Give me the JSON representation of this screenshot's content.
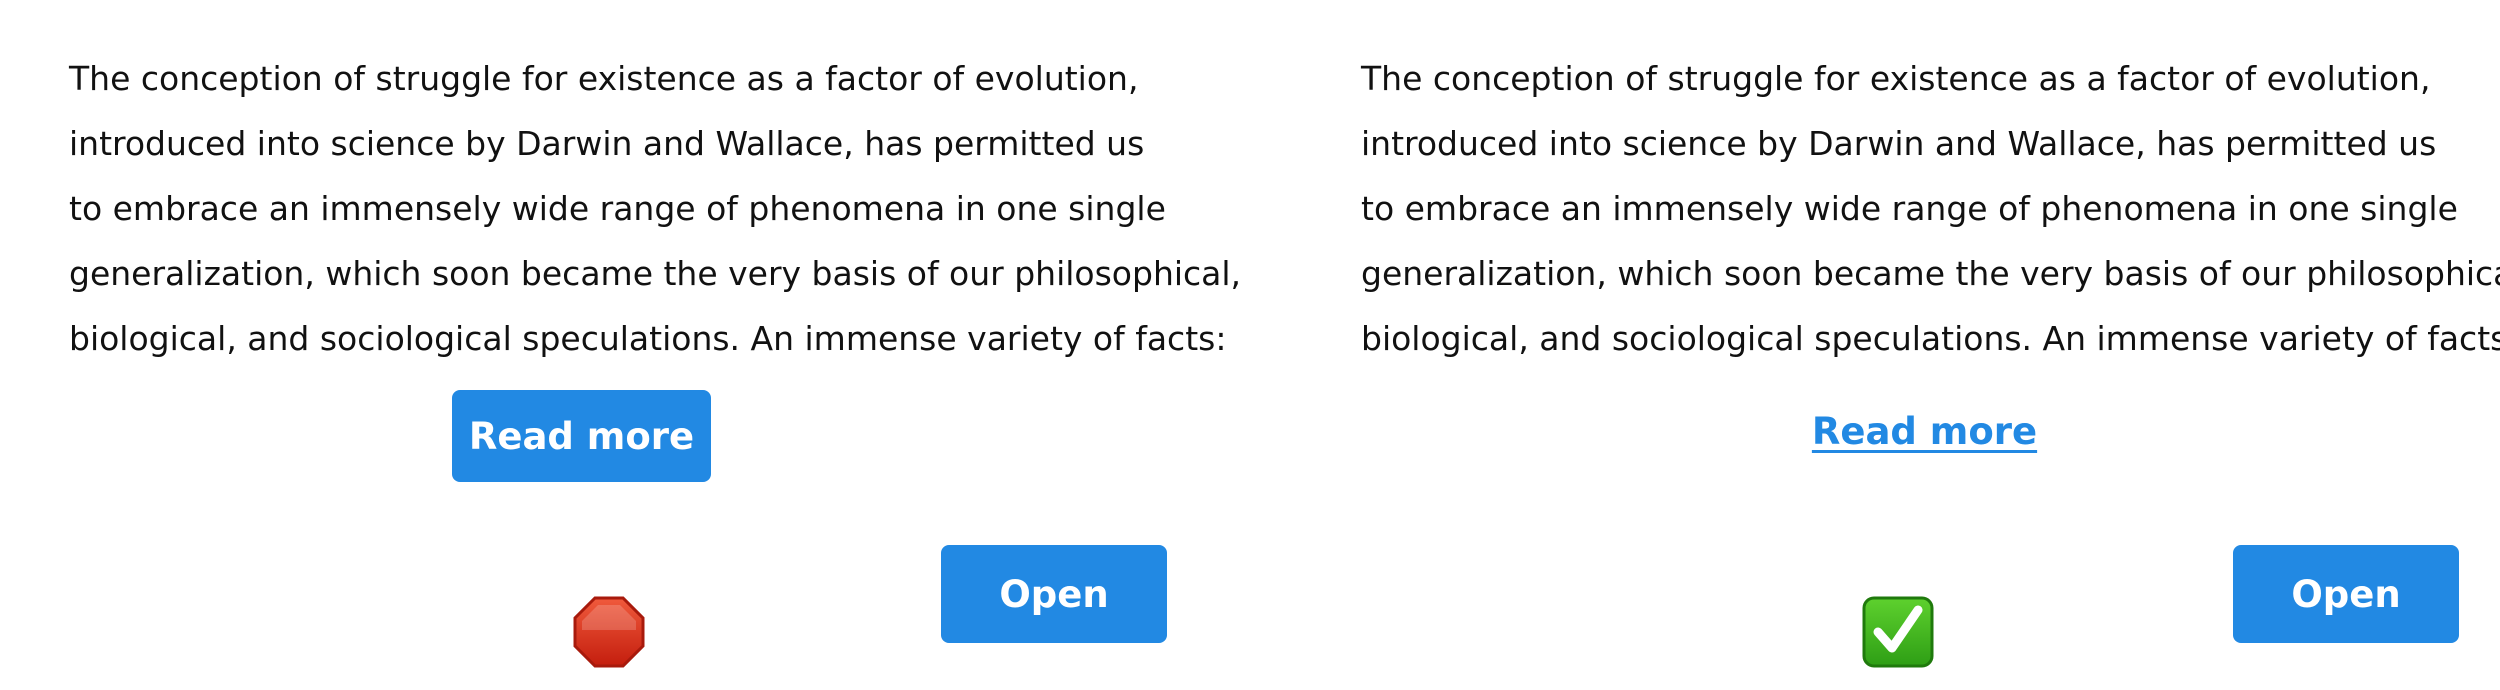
{
  "paragraph_lines": [
    "The conception of struggle for existence as a factor of evolution,",
    "introduced into science by Darwin and Wallace, has permitted us",
    "to embrace an immensely wide range of phenomena in one single",
    "generalization, which soon became the very basis of our philosophical,",
    "biological, and sociological speculations. An immense variety of facts:"
  ],
  "left_panel": {
    "read_more_label": "Read more",
    "open_label": "Open",
    "status_icon": "stop-sign-icon",
    "status_color": "#d9301c"
  },
  "right_panel": {
    "read_more_label": "Read more",
    "open_label": "Open",
    "status_icon": "check-mark-icon",
    "status_color": "#3fb820"
  },
  "colors": {
    "accent": "#2289e3",
    "text": "#111111",
    "background": "#ffffff"
  }
}
